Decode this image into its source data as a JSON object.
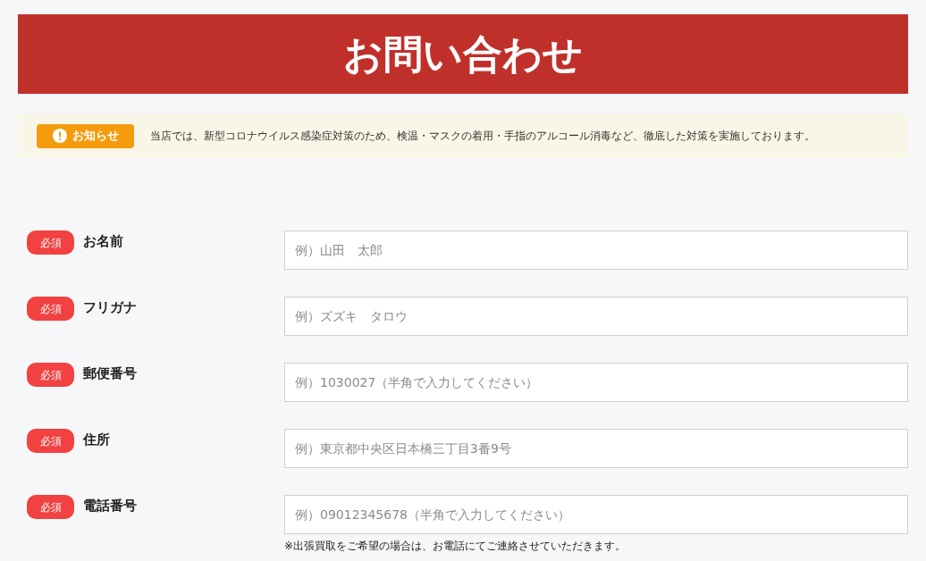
{
  "page_title": "お問い合わせ",
  "notice": {
    "label": "お知らせ",
    "text": "当店では、新型コロナウイルス感染症対策のため、検温・マスクの着用・手指のアルコール消毒など、徹底した対策を実施しております。"
  },
  "fields": [
    {
      "required": true,
      "badge": "必須",
      "label": "お名前",
      "placeholder": "例）山田　太郎"
    },
    {
      "required": true,
      "badge": "必須",
      "label": "フリガナ",
      "placeholder": "例）ズズキ　タロウ"
    },
    {
      "required": true,
      "badge": "必須",
      "label": "郵便番号",
      "placeholder": "例）1030027（半角で入力してください）"
    },
    {
      "required": true,
      "badge": "必須",
      "label": "住所",
      "placeholder": "例）東京都中央区日本橋三丁目3番9号"
    },
    {
      "required": true,
      "badge": "必須",
      "label": "電話番号",
      "placeholder": "例）09012345678（半角で入力してください）",
      "note": "※出張買取をご希望の場合は、お電話にてご連絡させていただきます。"
    }
  ]
}
